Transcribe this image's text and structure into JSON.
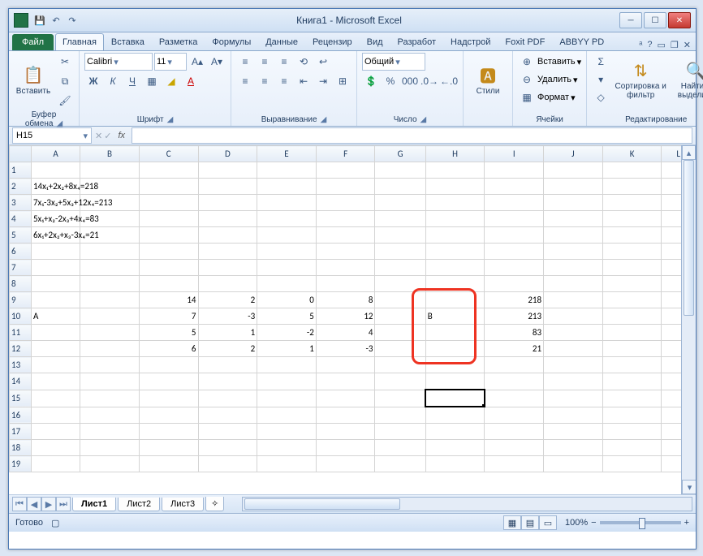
{
  "window_title": "Книга1 - Microsoft Excel",
  "qat": {
    "save": "💾",
    "undo": "↶",
    "redo": "↷"
  },
  "winbtns": {
    "min": "─",
    "max": "☐",
    "close": "✕"
  },
  "file_tab": "Файл",
  "tabs": [
    "Главная",
    "Вставка",
    "Разметка",
    "Формулы",
    "Данные",
    "Рецензир",
    "Вид",
    "Разработ",
    "Надстрой",
    "Foxit PDF",
    "ABBYY PD"
  ],
  "active_tab_index": 0,
  "help_icons": {
    "style": "ᵃ",
    "help": "?",
    "min": "▭",
    "restore": "❐",
    "close": "✕"
  },
  "ribbon": {
    "clipboard": {
      "label": "Буфер обмена",
      "paste": "Вставить",
      "paste_icon": "📋",
      "cut": "✂",
      "copy": "⧉",
      "brush": "🖌"
    },
    "font": {
      "label": "Шрифт",
      "name": "Calibri",
      "size": "11",
      "bold": "Ж",
      "italic": "К",
      "underline": "Ч",
      "border": "▦",
      "fill": "◢",
      "color": "A"
    },
    "align": {
      "label": "Выравнивание"
    },
    "number": {
      "label": "Число",
      "format": "Общий",
      "currency": "💲",
      "percent": "%",
      "comma": "000",
      "inc": ".0→",
      "dec": "←.0"
    },
    "styles": {
      "label": "",
      "btn": "Стили",
      "icon": "🅰"
    },
    "cells": {
      "label": "Ячейки",
      "insert": "Вставить",
      "delete": "Удалить",
      "format": "Формат"
    },
    "editing": {
      "label": "Редактирование",
      "sum": "Σ",
      "fill": "▾",
      "clear": "◇",
      "sort": "Сортировка и фильтр",
      "find": "Найти и выделить",
      "sort_icon": "⇅",
      "find_icon": "🔍"
    }
  },
  "namebox": "H15",
  "fx_label": "fx",
  "columns": [
    "A",
    "B",
    "C",
    "D",
    "E",
    "F",
    "G",
    "H",
    "I",
    "J",
    "K",
    "L"
  ],
  "equations": [
    "14x₁+2x₂+8x₄=218",
    "7x₁-3x₂+5x₃+12x₄=213",
    "5x₁+x₂-2x₃+4x₄=83",
    "6x₁+2x₂+x₃-3x₄=21"
  ],
  "matrixA_label": "A",
  "matrixB_label": "B",
  "matrixA": [
    [
      14,
      2,
      0,
      8
    ],
    [
      7,
      -3,
      5,
      12
    ],
    [
      5,
      1,
      -2,
      4
    ],
    [
      6,
      2,
      1,
      -3
    ]
  ],
  "vectorB": [
    218,
    213,
    83,
    21
  ],
  "sheets": [
    "Лист1",
    "Лист2",
    "Лист3"
  ],
  "active_sheet_index": 0,
  "status": "Готово",
  "zoom": "100%",
  "chart_data": null
}
